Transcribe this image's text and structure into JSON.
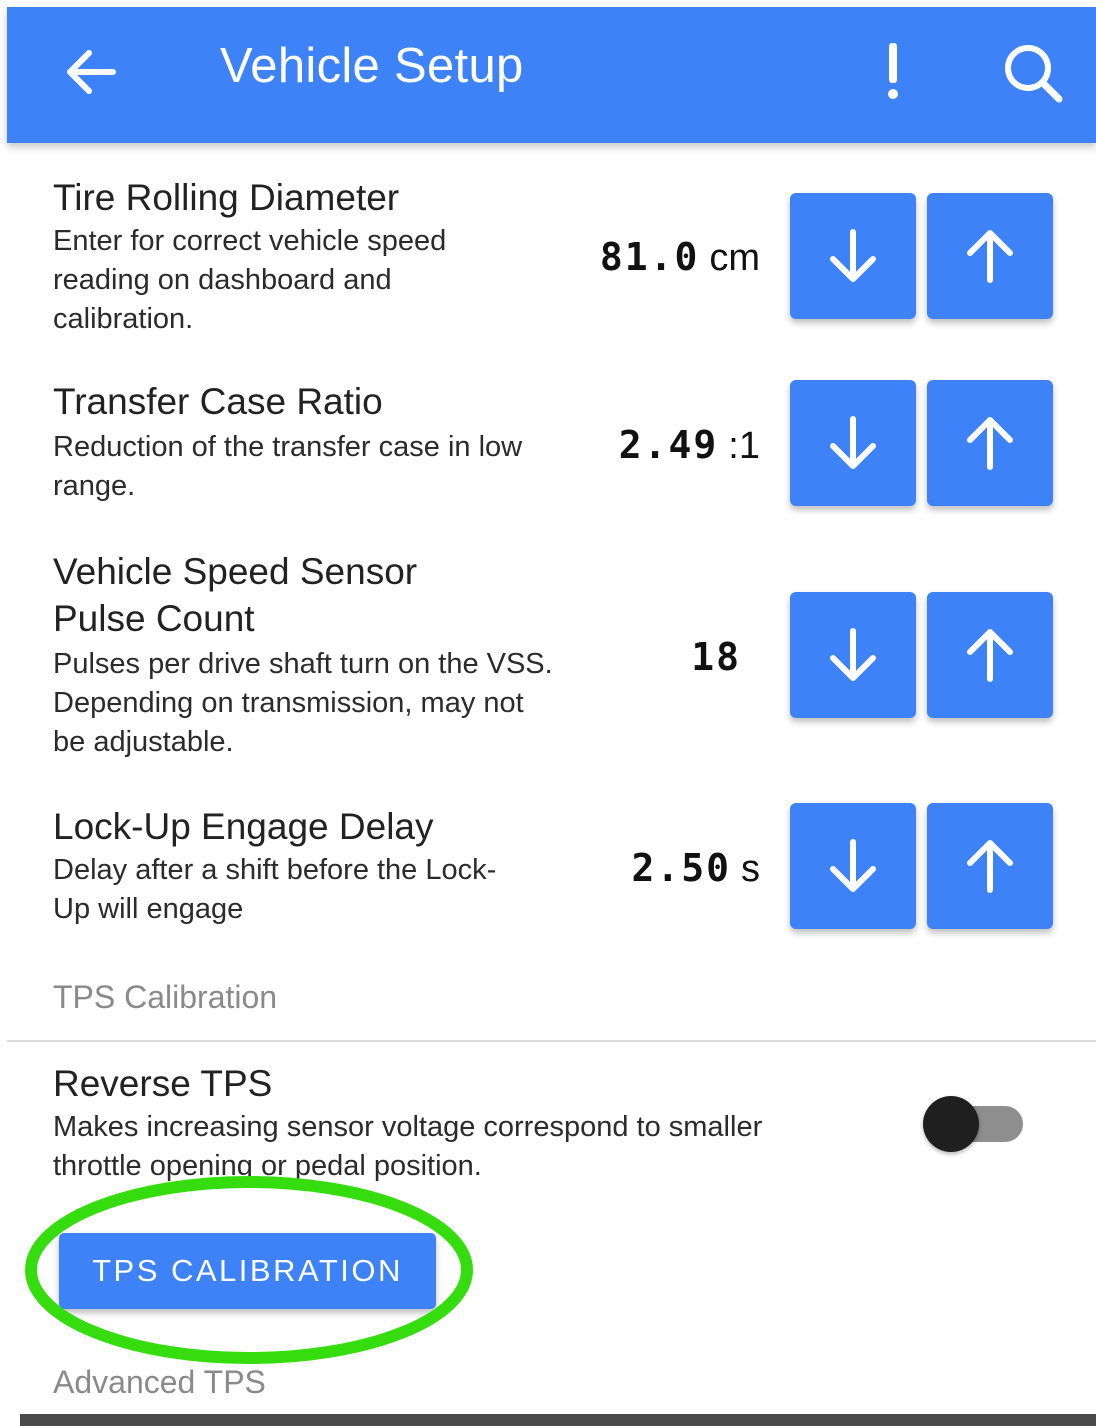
{
  "appbar": {
    "title": "Vehicle Setup",
    "back_icon": "arrow-left-icon",
    "alert_icon": "exclamation-icon",
    "search_icon": "search-icon",
    "color": "#3d82f7"
  },
  "settings": [
    {
      "name": "Tire Rolling Diameter",
      "description": "Enter for correct vehicle speed reading on dashboard and calibration.",
      "value": "81.0",
      "unit": "cm",
      "decrease_icon": "arrow-down-icon",
      "increase_icon": "arrow-up-icon"
    },
    {
      "name": "Transfer Case Ratio",
      "description": "Reduction of the transfer case in low range.",
      "value": "2.49",
      "unit": ":1",
      "decrease_icon": "arrow-down-icon",
      "increase_icon": "arrow-up-icon"
    },
    {
      "name": "Vehicle Speed Sensor Pulse Count",
      "description": "Pulses per drive shaft turn on the VSS. Depending on transmission, may not be adjustable.",
      "value": "18",
      "unit": "",
      "decrease_icon": "arrow-down-icon",
      "increase_icon": "arrow-up-icon"
    },
    {
      "name": "Lock-Up Engage Delay",
      "description": "Delay after a shift before the Lock-Up will engage",
      "value": "2.50",
      "unit": "s",
      "decrease_icon": "arrow-down-icon",
      "increase_icon": "arrow-up-icon"
    }
  ],
  "tps_section": {
    "header": "TPS Calibration",
    "reverse_tps": {
      "name": "Reverse TPS",
      "description": "Makes increasing sensor voltage correspond to smaller throttle opening or pedal position.",
      "enabled": false
    },
    "calibration_button": "TPS CALIBRATION",
    "highlight_color": "#35dd0f"
  },
  "advanced_section": {
    "header": "Advanced TPS"
  }
}
